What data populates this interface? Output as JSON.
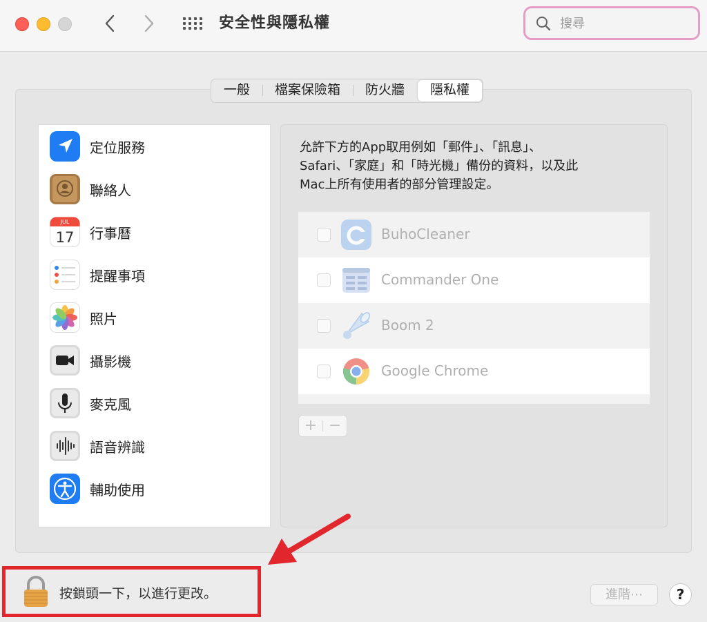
{
  "window": {
    "title": "安全性與隱私權",
    "search_placeholder": "搜尋"
  },
  "tabs": [
    {
      "label": "一般"
    },
    {
      "label": "檔案保險箱"
    },
    {
      "label": "防火牆"
    },
    {
      "label": "隱私權",
      "active": true
    }
  ],
  "sidebar": {
    "items": [
      {
        "label": "定位服務",
        "icon": "location-arrow-icon"
      },
      {
        "label": "聯絡人",
        "icon": "contacts-icon"
      },
      {
        "label": "行事曆",
        "icon": "calendar-icon",
        "icon_month": "JUL",
        "icon_day": "17"
      },
      {
        "label": "提醒事項",
        "icon": "reminders-icon"
      },
      {
        "label": "照片",
        "icon": "photos-icon"
      },
      {
        "label": "攝影機",
        "icon": "camera-icon"
      },
      {
        "label": "麥克風",
        "icon": "microphone-icon"
      },
      {
        "label": "語音辨識",
        "icon": "speech-recognition-icon"
      },
      {
        "label": "輔助使用",
        "icon": "accessibility-icon"
      }
    ]
  },
  "main": {
    "description": "允許下方的App取用例如「郵件」、「訊息」、\nSafari、「家庭」和「時光機」備份的資料，以及此\nMac上所有使用者的部分管理設定。",
    "apps": [
      {
        "name": "BuhoCleaner",
        "icon": "buhocleaner-icon",
        "checked": false
      },
      {
        "name": "Commander One",
        "icon": "commander-one-icon",
        "checked": false
      },
      {
        "name": "Boom 2",
        "icon": "boom-icon",
        "checked": false
      },
      {
        "name": "Google Chrome",
        "icon": "chrome-icon",
        "checked": false
      }
    ],
    "add_label": "+",
    "remove_label": "−"
  },
  "footer": {
    "lock_text": "按鎖頭一下，以進行更改。",
    "advanced_label": "進階⋯",
    "help_label": "?"
  },
  "colors": {
    "highlight_red": "#e2262e",
    "search_highlight": "#e59cc6"
  }
}
